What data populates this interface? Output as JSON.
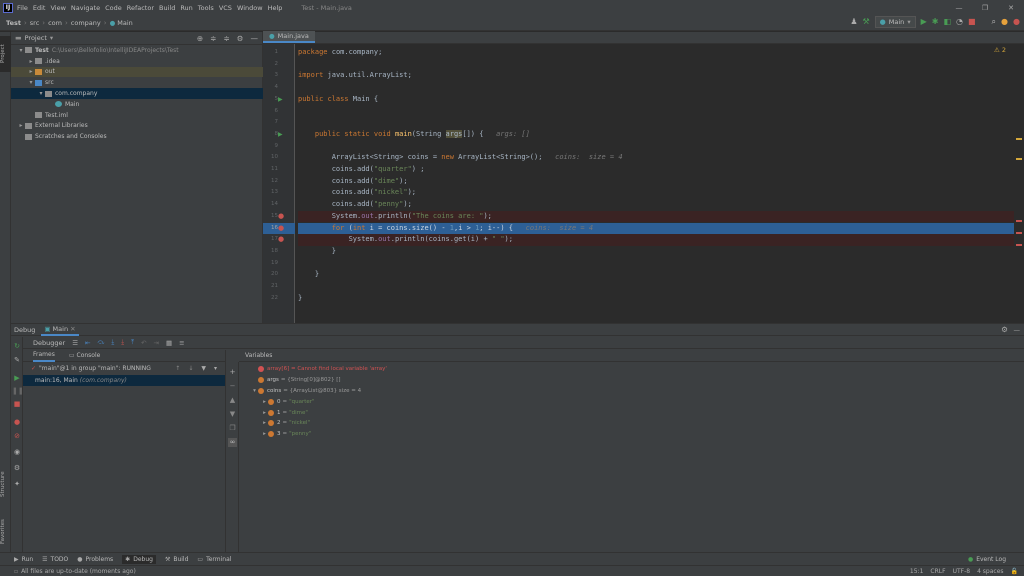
{
  "titlebar": {
    "logo": "IJ",
    "menu": [
      "File",
      "Edit",
      "View",
      "Navigate",
      "Code",
      "Refactor",
      "Build",
      "Run",
      "Tools",
      "VCS",
      "Window",
      "Help"
    ],
    "title": "Test - Main.java",
    "controls": {
      "minimize": "—",
      "maximize": "❐",
      "close": "✕"
    }
  },
  "navbar": {
    "crumbs": [
      "Test",
      "src",
      "com",
      "company",
      "Main"
    ],
    "run_config": "Main"
  },
  "left_stripe": {
    "project": "Project",
    "structure": "Structure",
    "favorites": "Favorites"
  },
  "project": {
    "title": "Project",
    "tree": [
      {
        "label": "Test",
        "path": "C:\\Users\\Bellofolio\\IntelliJIDEAProjects\\Test",
        "depth": 0,
        "arrow": "▾",
        "icon": "folder",
        "bold": true
      },
      {
        "label": ".idea",
        "depth": 1,
        "arrow": "▸",
        "icon": "folder"
      },
      {
        "label": "out",
        "depth": 1,
        "arrow": "▸",
        "icon": "folder-orange"
      },
      {
        "label": "src",
        "depth": 1,
        "arrow": "▾",
        "icon": "folder-blue"
      },
      {
        "label": "com.company",
        "depth": 2,
        "arrow": "▾",
        "icon": "package"
      },
      {
        "label": "Main",
        "depth": 3,
        "arrow": "",
        "icon": "class"
      },
      {
        "label": "Test.iml",
        "depth": 1,
        "arrow": "",
        "icon": "file"
      },
      {
        "label": "External Libraries",
        "depth": 0,
        "arrow": "▸",
        "icon": "library"
      },
      {
        "label": "Scratches and Consoles",
        "depth": 0,
        "arrow": "",
        "icon": "scratch"
      }
    ]
  },
  "editor": {
    "tab": "Main.java",
    "warnings": "⚠ 2",
    "lines": [
      {
        "n": "1",
        "html": "<span class='kw'>package</span> com.company;"
      },
      {
        "n": "2",
        "html": ""
      },
      {
        "n": "3",
        "html": "<span class='kw'>import</span> java.util.ArrayList;"
      },
      {
        "n": "4",
        "html": ""
      },
      {
        "n": "5",
        "html": "<span class='kw'>public class</span> Main {"
      },
      {
        "n": "6",
        "html": ""
      },
      {
        "n": "7",
        "html": ""
      },
      {
        "n": "8",
        "html": "    <span class='kw'>public static void</span> <span class='fn'>main</span>(String <span style='background:#52503a'>args</span>[]) {   <span class='hint'>args: []</span>"
      },
      {
        "n": "9",
        "html": ""
      },
      {
        "n": "10",
        "html": "        ArrayList&lt;String&gt; coins = <span class='kw'>new</span> ArrayList&lt;String&gt;();   <span class='hint'>coins:  size = 4</span>"
      },
      {
        "n": "11",
        "html": "        coins.add(<span class='st'>\"quarter\"</span>) ;"
      },
      {
        "n": "12",
        "html": "        coins.add(<span class='st'>\"dime\"</span>);"
      },
      {
        "n": "13",
        "html": "        coins.add(<span class='st'>\"nickel\"</span>);"
      },
      {
        "n": "14",
        "html": "        coins.add(<span class='st'>\"penny\"</span>);"
      },
      {
        "n": "15",
        "html": "        System.<span class='fld'>out</span>.println(<span class='st'>\"The coins are: \"</span>);"
      },
      {
        "n": "16",
        "html": "        <span class='kw'>for</span> (<span class='kw'>int</span> i = coins.size() - <span style='color:#6897bb'>1</span>,i &gt; <span style='color:#6897bb'>1</span>; i--) {   <span class='hint'>coins:  size = 4</span>"
      },
      {
        "n": "17",
        "html": "            System.<span class='fld'>out</span>.println(coins.get(i) + <span class='st'>\" \"</span>);"
      },
      {
        "n": "18",
        "html": "        }"
      },
      {
        "n": "19",
        "html": ""
      },
      {
        "n": "20",
        "html": "    }"
      },
      {
        "n": "21",
        "html": ""
      },
      {
        "n": "22",
        "html": "}"
      }
    ]
  },
  "debug": {
    "title": "Debug",
    "session_tab": "Main",
    "toolbar_label": "Debugger",
    "subtabs": [
      "Frames",
      "Console"
    ],
    "thread": "\"main\"@1 in group \"main\": RUNNING",
    "frame": "main:16, Main",
    "frame_pkg": "(com.company)",
    "variables_title": "Variables",
    "variables": [
      {
        "depth": 0,
        "arrow": "",
        "icon": "#d25252",
        "name": "array[6] = Cannot find local variable 'array'",
        "value": "",
        "err": true
      },
      {
        "depth": 0,
        "arrow": "",
        "icon": "#cc7832",
        "name": "args",
        "value": "= {String[0]@802} []"
      },
      {
        "depth": 0,
        "arrow": "▾",
        "icon": "#cc7832",
        "name": "coins",
        "value": "= {ArrayList@803}  size = 4"
      },
      {
        "depth": 1,
        "arrow": "▸",
        "icon": "#cc7832",
        "name": "0",
        "value": "=",
        "str": "\"quarter\""
      },
      {
        "depth": 1,
        "arrow": "▸",
        "icon": "#cc7832",
        "name": "1",
        "value": "=",
        "str": "\"dime\""
      },
      {
        "depth": 1,
        "arrow": "▸",
        "icon": "#cc7832",
        "name": "2",
        "value": "=",
        "str": "\"nickel\""
      },
      {
        "depth": 1,
        "arrow": "▸",
        "icon": "#cc7832",
        "name": "3",
        "value": "=",
        "str": "\"penny\""
      }
    ]
  },
  "toolwindows": [
    {
      "icon": "▶",
      "label": "Run"
    },
    {
      "icon": "☰",
      "label": "TODO"
    },
    {
      "icon": "●",
      "label": "Problems"
    },
    {
      "icon": "✱",
      "label": "Debug",
      "active": true
    },
    {
      "icon": "⚒",
      "label": "Build"
    },
    {
      "icon": "▭",
      "label": "Terminal"
    }
  ],
  "event_log": "Event Log",
  "status": {
    "message": "All files are up-to-date (moments ago)",
    "position": "15:1",
    "line_sep": "CRLF",
    "encoding": "UTF-8",
    "indent": "4 spaces"
  },
  "colors": {
    "accent": "#4a88c7",
    "current_line": "#2d5f95",
    "breakpoint": "#c75450",
    "run": "#499c54"
  }
}
